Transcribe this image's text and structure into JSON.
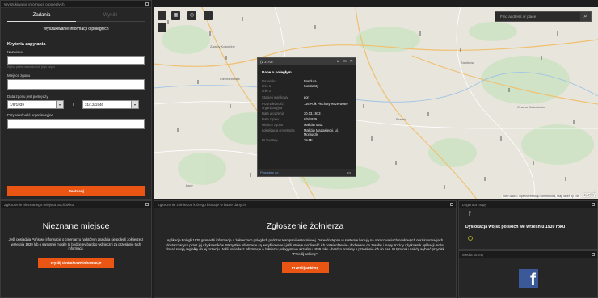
{
  "query_panel": {
    "title": "Wyszukiwanie informacji o poległych",
    "tabs": [
      "Zadania",
      "Wyniki"
    ],
    "subtitle": "Wyszukiwanie informacji o poległych",
    "section": "Kryteria zapytania",
    "surname_label": "Nazwisko",
    "surname_hint": "Wpisz pełne nazwisko lub jego część",
    "place_label": "Miejsce zgonu",
    "date_label": "Data zgonu jest pomiędzy",
    "date_from": "1/8/1939",
    "date_sep": "i",
    "date_to": "31/12/1946",
    "org_label": "Przynależność organizacyjna",
    "submit": "Zastosuj"
  },
  "map": {
    "search_placeholder": "Find address or place",
    "attribution": "Map data © OpenStreetMap contributors, Map layer by Esri",
    "logo": "esri",
    "controls": [
      "+",
      "−"
    ],
    "town_labels": [
      "Zaręby Kościelne",
      "Ciechanowiec",
      "Czarna Białostocka",
      "Brańsk",
      "Zambrów",
      "Łapy"
    ]
  },
  "popup": {
    "header": "(1 z 70)",
    "name": "Dane o poległym",
    "fields": [
      {
        "k": "Nazwisko",
        "v": "Bandura"
      },
      {
        "k": "Imię 1",
        "v": "Konstanty"
      },
      {
        "k": "Imię 2",
        "v": ""
      },
      {
        "k": "Stopień wojskowy",
        "v": "por"
      },
      {
        "k": "Przynależność organizacyjna",
        "v": "116 Pułk Piechoty Rezerwowy"
      },
      {
        "k": "Data urodzenia",
        "v": "30.03.1913"
      },
      {
        "k": "Data zgonu",
        "v": "8/9/1939"
      },
      {
        "k": "Miejsce zgonu",
        "v": "Małków Maz."
      },
      {
        "k": "Lokalizacja cmentarza",
        "v": "Małków Mazowiecki, ul. Moniuszki"
      },
      {
        "k": "Nr kwatery",
        "v": "28-MI"
      }
    ],
    "zoom_link": "Powiększ do"
  },
  "unknown_panel": {
    "title": "Zgłoszenie nieznanego miejsca pochówku",
    "heading": "Nieznane miejsce",
    "text": "Jeśli posiadają Państwo informacje o cmentarzu na którym znajdują się polegli żołnierze z września 1939 lub o samotnej mogile to będziemy bardzo wdzięczni za przesłanie tych informacji.",
    "button": "Wyślij dodatkowe informacje"
  },
  "report_panel": {
    "title": "Zgłoszenie żołnierza, którego brakuje w bazie danych",
    "heading": "Zgłoszenie żołnierza",
    "text": "Aplikacja Polegli 1939 gromadzi informacje o żołnierzach poległych podczas Kampanii wrześniowej. Dane dostępne w systemie bazują na opracowaniach naukowych oraz informacjach dostarczanych przez jej użytkowników. Wszystkie informacje są weryfikowane i jeśli istnieje możliwość ich potwierdzenia - dodawane do zasobu i mapy. Każdy użytkownik aplikacji może dodać swoją cegiełkę do jej rozwoju. Jeśli posiadasz informacje o żołnierzu poległym we wrześniu 1939 roku - bardzo prosimy o przesłanie ich do nas. W tym celu należy wybrać przycisk \"Prześlij ankietę\".",
    "button": "Prześlij ankietę"
  },
  "legend_panel": {
    "title": "Legenda mapy",
    "entry": "Dyslokacja wojsk polskich we wrześniu 1939 roku"
  },
  "media_panel": {
    "title": "Media strony",
    "fb": "f"
  },
  "colors": {
    "accent": "#ea5514",
    "panel": "#262626",
    "facebook": "#3b5998"
  }
}
